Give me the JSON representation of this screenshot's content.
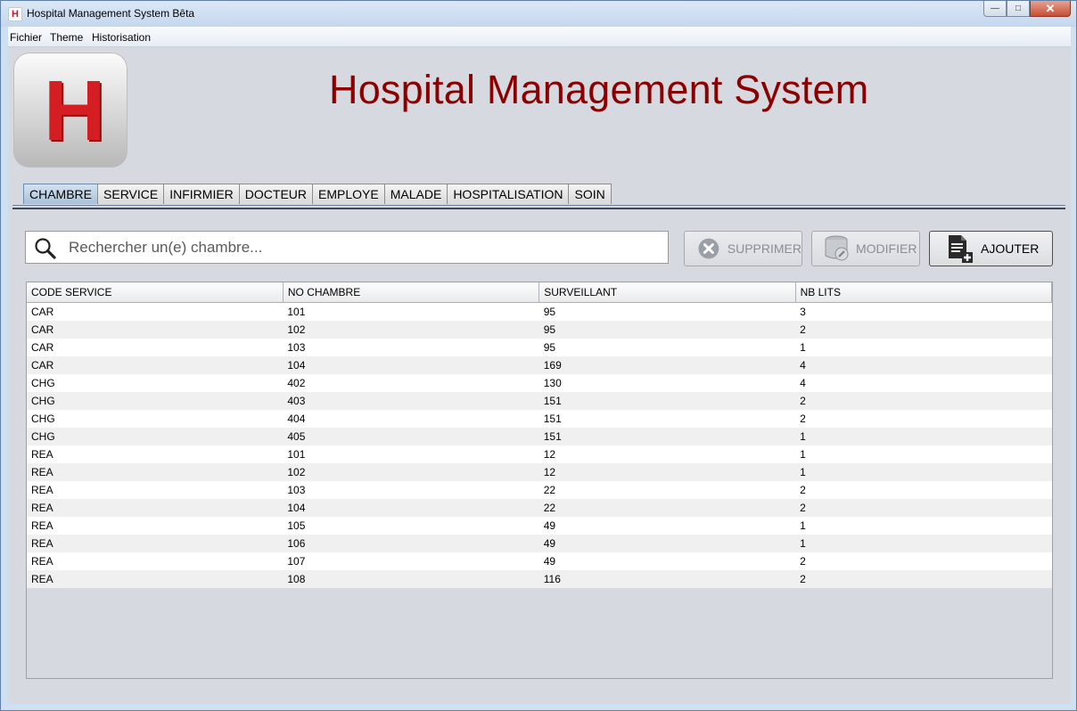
{
  "window": {
    "title": "Hospital Management System Bêta",
    "icon_letter": "H"
  },
  "menu": {
    "items": [
      "Fichier",
      "Theme",
      "Historisation"
    ]
  },
  "header": {
    "logo_letter": "H",
    "title": "Hospital Management System"
  },
  "tabs": [
    "CHAMBRE",
    "SERVICE",
    "INFIRMIER",
    "DOCTEUR",
    "EMPLOYE",
    "MALADE",
    "HOSPITALISATION",
    "SOIN"
  ],
  "active_tab": "CHAMBRE",
  "search": {
    "placeholder": "Rechercher un(e) chambre..."
  },
  "actions": {
    "delete_label": "SUPPRIMER",
    "modify_label": "MODIFIER",
    "add_label": "AJOUTER"
  },
  "table": {
    "columns": [
      "CODE SERVICE",
      "NO CHAMBRE",
      "SURVEILLANT",
      "NB LITS"
    ],
    "rows": [
      [
        "CAR",
        "101",
        "95",
        "3"
      ],
      [
        "CAR",
        "102",
        "95",
        "2"
      ],
      [
        "CAR",
        "103",
        "95",
        "1"
      ],
      [
        "CAR",
        "104",
        "169",
        "4"
      ],
      [
        "CHG",
        "402",
        "130",
        "4"
      ],
      [
        "CHG",
        "403",
        "151",
        "2"
      ],
      [
        "CHG",
        "404",
        "151",
        "2"
      ],
      [
        "CHG",
        "405",
        "151",
        "1"
      ],
      [
        "REA",
        "101",
        "12",
        "1"
      ],
      [
        "REA",
        "102",
        "12",
        "1"
      ],
      [
        "REA",
        "103",
        "22",
        "2"
      ],
      [
        "REA",
        "104",
        "22",
        "2"
      ],
      [
        "REA",
        "105",
        "49",
        "1"
      ],
      [
        "REA",
        "106",
        "49",
        "1"
      ],
      [
        "REA",
        "107",
        "49",
        "2"
      ],
      [
        "REA",
        "108",
        "116",
        "2"
      ]
    ]
  },
  "colors": {
    "title_red": "#8b0000",
    "logo_red": "#d41e24",
    "active_tab": "#a9c1da"
  }
}
